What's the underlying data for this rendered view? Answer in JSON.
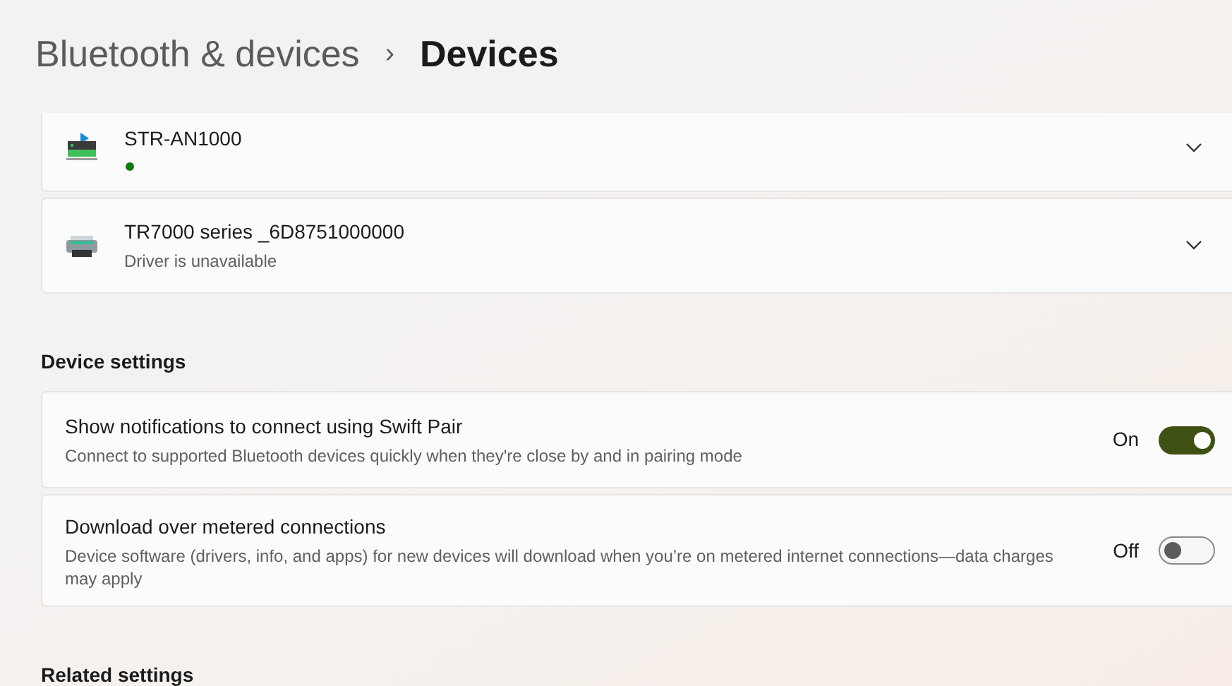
{
  "breadcrumb": {
    "parent": "Bluetooth & devices",
    "separator": "›",
    "current": "Devices"
  },
  "devices": [
    {
      "name": "STR-AN1000",
      "color": "#0f7b0f"
    },
    {
      "name": "TR7000 series _6D8751000000",
      "status": "Driver is unavailable"
    }
  ],
  "device_settings": {
    "title": "Device settings",
    "items": [
      {
        "title": "Show notifications to connect using Swift Pair",
        "description": "Connect to supported Bluetooth devices quickly when they're close by and in pairing mode",
        "state_label": "On",
        "on": true
      },
      {
        "title": "Download over metered connections",
        "description": "Device software (drivers, info, and apps) for new devices will download when you’re on metered internet connections—data charges may apply",
        "state_label": "Off",
        "on": false
      }
    ]
  },
  "related_settings": {
    "title": "Related settings"
  }
}
